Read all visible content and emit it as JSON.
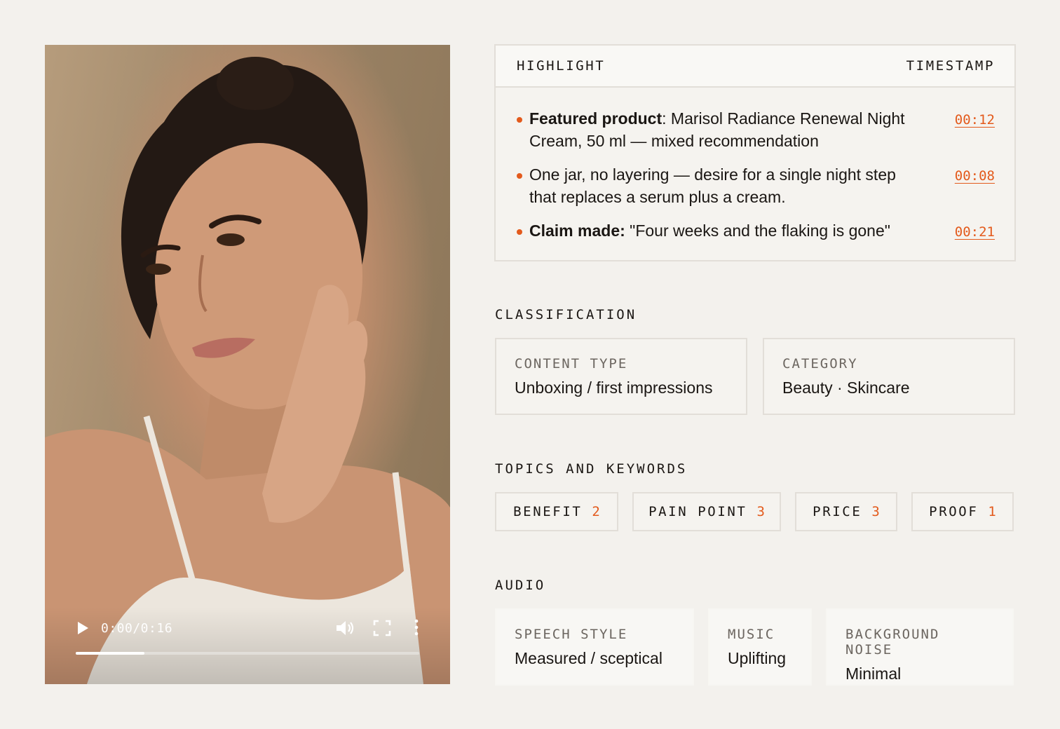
{
  "video": {
    "time": "0:00/0:16",
    "progress": 0.2,
    "icons": {
      "play": "play-icon",
      "volume": "volume-icon",
      "fullscreen": "fullscreen-icon",
      "more": "more-vertical-icon"
    }
  },
  "highlights": {
    "header_left": "HIGHLIGHT",
    "header_right": "TIMESTAMP",
    "items": [
      {
        "bold": "Featured product",
        "text": ": Marisol Radiance Renewal Night Cream, 50 ml — mixed recommendation",
        "timestamp": "00:12"
      },
      {
        "bold": "",
        "text": "One jar, no layering — desire for a single night step that replaces a serum plus a cream.",
        "timestamp": "00:08"
      },
      {
        "bold": "Claim made:",
        "text": " \"Four weeks and the flaking is gone\"",
        "timestamp": "00:21"
      }
    ]
  },
  "classification": {
    "title": "CLASSIFICATION",
    "content_type_label": "CONTENT TYPE",
    "content_type_value": "Unboxing / first impressions",
    "category_label": "CATEGORY",
    "category_value": "Beauty · Skincare"
  },
  "topics": {
    "title": "TOPICS AND KEYWORDS",
    "chips": [
      {
        "label": "BENEFIT",
        "count": "2"
      },
      {
        "label": "PAIN POINT",
        "count": "3"
      },
      {
        "label": "PRICE",
        "count": "3"
      },
      {
        "label": "PROOF",
        "count": "1"
      }
    ]
  },
  "audio": {
    "title": "AUDIO",
    "speech_label": "SPEECH STYLE",
    "speech_value": "Measured / sceptical",
    "music_label": "MUSIC",
    "music_value": "Uplifting",
    "noise_label": "BACKGROUND NOISE",
    "noise_value": "Minimal"
  },
  "colors": {
    "accent": "#e35a1c",
    "background": "#f3f1ed",
    "border": "#e2ded8"
  }
}
